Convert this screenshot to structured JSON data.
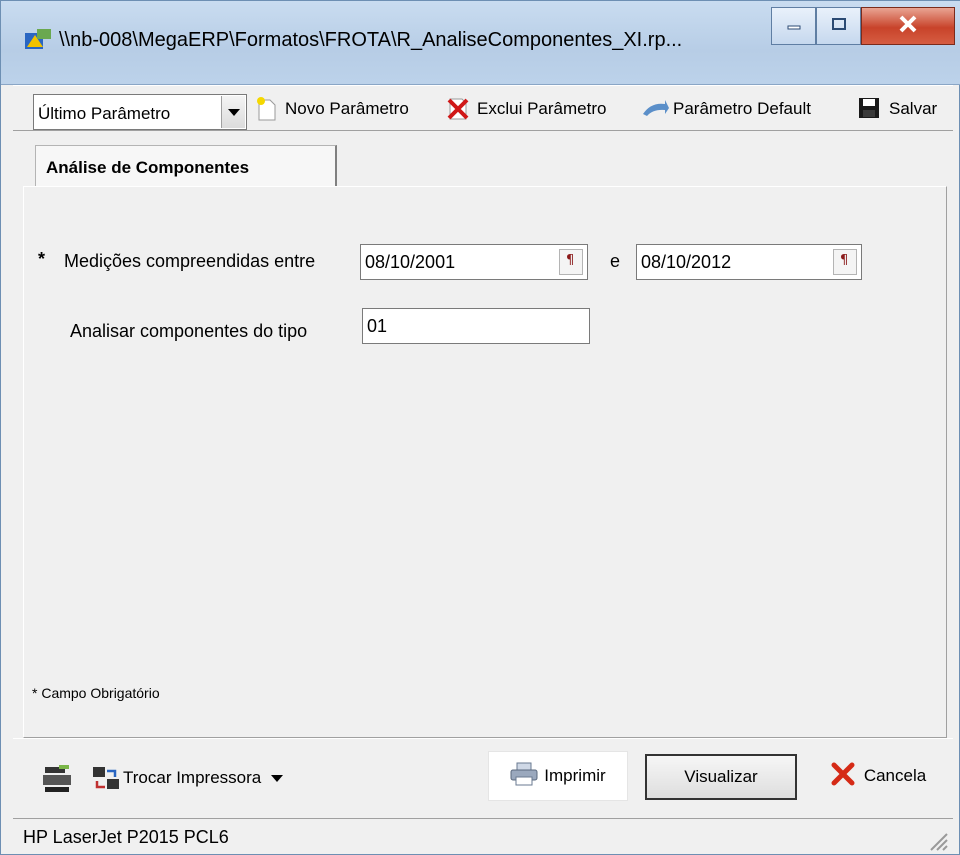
{
  "window": {
    "title": "\\\\nb-008\\MegaERP\\Formatos\\FROTA\\R_AnaliseComponentes_XI.rp...",
    "icons": [
      "app-icon",
      "minimize-icon",
      "maximize-icon",
      "close-icon"
    ]
  },
  "toolbar": {
    "parameter_select": "Último Parâmetro",
    "novo": "Novo Parâmetro",
    "exclui": "Exclui Parâmetro",
    "default": "Parâmetro Default",
    "salvar": "Salvar"
  },
  "tabs": [
    {
      "label": "Análise de Componentes"
    }
  ],
  "form": {
    "required_marker": "*",
    "medicoes_label": "Medições compreendidas entre",
    "date_from": "08/10/2001",
    "between": "e",
    "date_to": "08/10/2012",
    "tipo_label": "Analisar componentes do tipo",
    "tipo_value": "01",
    "footnote": "* Campo Obrigatório"
  },
  "bottom": {
    "trocar": "Trocar Impressora",
    "imprimir": "Imprimir",
    "visualizar": "Visualizar",
    "cancela": "Cancela"
  },
  "status": {
    "printer": "HP LaserJet P2015 PCL6"
  },
  "colors": {
    "accent_close": "#c8432a",
    "title_gradient": "#c9dcf0"
  }
}
